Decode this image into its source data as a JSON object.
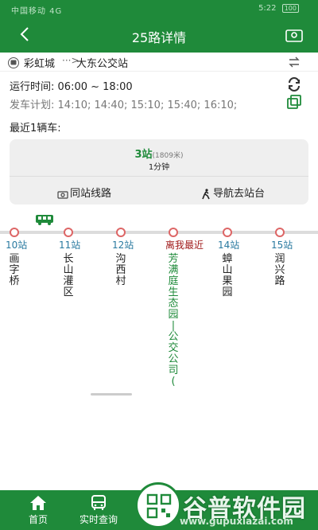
{
  "status_bar": {
    "left": "中国移动 4G",
    "right": "5:22",
    "battery": "100"
  },
  "header": {
    "title": "25路详情"
  },
  "route": {
    "from": "彩虹城",
    "arrow": "···>",
    "to": "大东公交站"
  },
  "schedule": {
    "run_time_label": "运行时间:",
    "run_time": "06:00 ~ 18:00",
    "plan_label": "发车计划:",
    "plan": "14:10; 14:40; 15:10; 15:40; 16:10;"
  },
  "recent": {
    "label": "最近1辆车:"
  },
  "card": {
    "stops": "3站",
    "distance": "(1809米)",
    "minutes": "1分钟",
    "action_lines": "同站线路",
    "action_nav": "导航去站台"
  },
  "stops": [
    {
      "label": "10站",
      "name": [
        "画",
        "字",
        "桥"
      ]
    },
    {
      "label": "11站",
      "name": [
        "长",
        "山",
        "灌",
        "区"
      ]
    },
    {
      "label": "12站",
      "name": [
        "沟",
        "西",
        "村"
      ]
    },
    {
      "label": "离我最近",
      "name": [
        "芳",
        "满",
        "庭",
        "生",
        "态",
        "园",
        "|",
        "公",
        "交",
        "公",
        "司",
        "("
      ]
    },
    {
      "label": "14站",
      "name": [
        "蟑",
        "山",
        "果",
        "园"
      ]
    },
    {
      "label": "15站",
      "name": [
        "润",
        "兴",
        "路"
      ]
    }
  ],
  "nav": {
    "home": "首页",
    "realtime": "实时查询"
  },
  "watermark": {
    "big": "谷普软件园",
    "small": "www.gupuxiazai.com"
  },
  "colors": {
    "primary": "#1f8a3a",
    "near_label": "#a01b1b",
    "stop_label": "#2a7aa0"
  }
}
